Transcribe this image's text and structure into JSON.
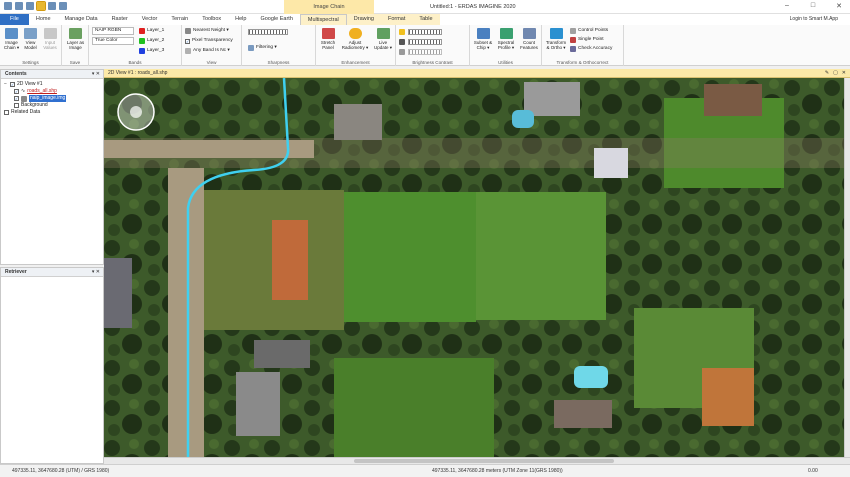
{
  "titlebar": {
    "context_tab_title": "Image Chain",
    "window_title": "Untitled:1 - ERDAS IMAGINE 2020",
    "controls": [
      "–",
      "□",
      "✕"
    ]
  },
  "tabs": [
    "File",
    "Home",
    "Manage Data",
    "Raster",
    "Vector",
    "Terrain",
    "Toolbox",
    "Help",
    "Google Earth",
    "Multispectral",
    "Drawing",
    "Format",
    "Table"
  ],
  "login": "Login to Smart M.App",
  "ribbon": {
    "settings": {
      "label": "Settings",
      "image_chain": "Image Chain ▾",
      "view_model": "View Model",
      "input_values": "Input Values"
    },
    "save": {
      "label": "Save",
      "layer_as_image": "Layer as Image"
    },
    "bands": {
      "label": "Bands",
      "band_combo": "NAIP RGBN",
      "color_mode": "True Color",
      "layer1": "Layer_1",
      "layer2": "Layer_2",
      "layer3": "Layer_3"
    },
    "view": {
      "label": "View",
      "resample": "Nearest Neight ▾",
      "pixel_transparency": "Pixel Transparency",
      "any_band": "Any Band Is Nc ▾"
    },
    "sharpness": {
      "label": "Sharpness",
      "filtering": "Filtering ▾"
    },
    "enhancement": {
      "label": "Enhancement",
      "stretch_panel": "Stretch Panel",
      "adjust_radiometry": "Adjust Radiometry ▾",
      "live_update": "Live Update ▾"
    },
    "brightness": {
      "label": "Brightness Contrast"
    },
    "utilities": {
      "label": "Utilities",
      "subset": "Subset & Chip ▾",
      "spectral_profile": "Spectral Profile ▾",
      "count_features": "Count Features"
    },
    "transform": {
      "label": "Transform & Orthocorrect",
      "transform_ortho": "Transform & Ortho ▾",
      "control_points": "Control Points",
      "single_point": "Single Point",
      "check_accuracy": "Check Accuracy"
    }
  },
  "contents": {
    "title": "Contents",
    "pin": "▾ ✕",
    "view_item": "2D View #1",
    "layer1": "roads_all.shp",
    "layer2": "naip_image.img",
    "background": "Background",
    "related": "Related Data"
  },
  "retriever": {
    "title": "Retriever",
    "pin": "▾ ✕"
  },
  "view_header": {
    "title": "2D View #1 : roads_all.shp",
    "icons": [
      "✎",
      "▢",
      "✕"
    ]
  },
  "status": {
    "left_coords": "497335.11, 3647680.28 (UTM) / GRS 1980)",
    "center_coords": "497335.11, 3647680.28 meters (UTM Zone 11(GRS 1980))",
    "right_value": "0.00"
  },
  "colors": {
    "file_tab": "#2f6fc4",
    "context_tab": "#fde8a8",
    "road_line": "#3fd0f0"
  }
}
